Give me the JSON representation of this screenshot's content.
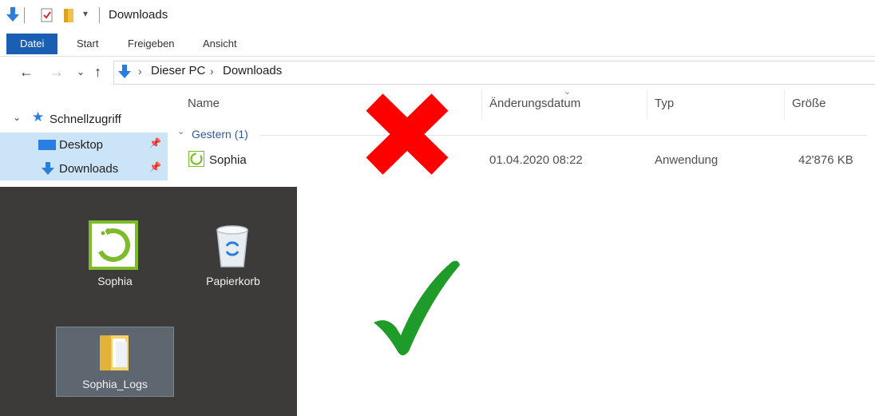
{
  "window": {
    "title": "Downloads"
  },
  "ribbon": {
    "tabs": [
      {
        "label": "Datei",
        "active": true
      },
      {
        "label": "Start"
      },
      {
        "label": "Freigeben"
      },
      {
        "label": "Ansicht"
      }
    ]
  },
  "address": {
    "crumbs": [
      "Dieser PC",
      "Downloads"
    ]
  },
  "navigation": {
    "quick_access": "Schnellzugriff",
    "items": [
      {
        "label": "Desktop",
        "icon": "desktop-icon"
      },
      {
        "label": "Downloads",
        "icon": "download-arrow-icon",
        "selected": true
      }
    ]
  },
  "file_list": {
    "columns": [
      "Name",
      "Änderungsdatum",
      "Typ",
      "Größe"
    ],
    "group": "Gestern (1)",
    "rows": [
      {
        "name": "Sophia",
        "date": "01.04.2020 08:22",
        "type": "Anwendung",
        "size": "42'876 KB"
      }
    ]
  },
  "desktop": {
    "icons": [
      {
        "label": "Sophia",
        "icon": "sophia-app-icon"
      },
      {
        "label": "Papierkorb",
        "icon": "recycle-bin-icon"
      },
      {
        "label": "Sophia_Logs",
        "icon": "folder-icon",
        "selected": true
      }
    ]
  },
  "colors": {
    "accent": "#1a5fb4",
    "selection": "#cce4f7",
    "desktop_bg": "#3c3b39",
    "sophia_green": "#7dbb2a",
    "wrong_red": "#ff0000",
    "right_green": "#1f9b2a"
  },
  "annotations": {
    "wrong": "cross-mark-icon",
    "right": "check-mark-icon"
  }
}
